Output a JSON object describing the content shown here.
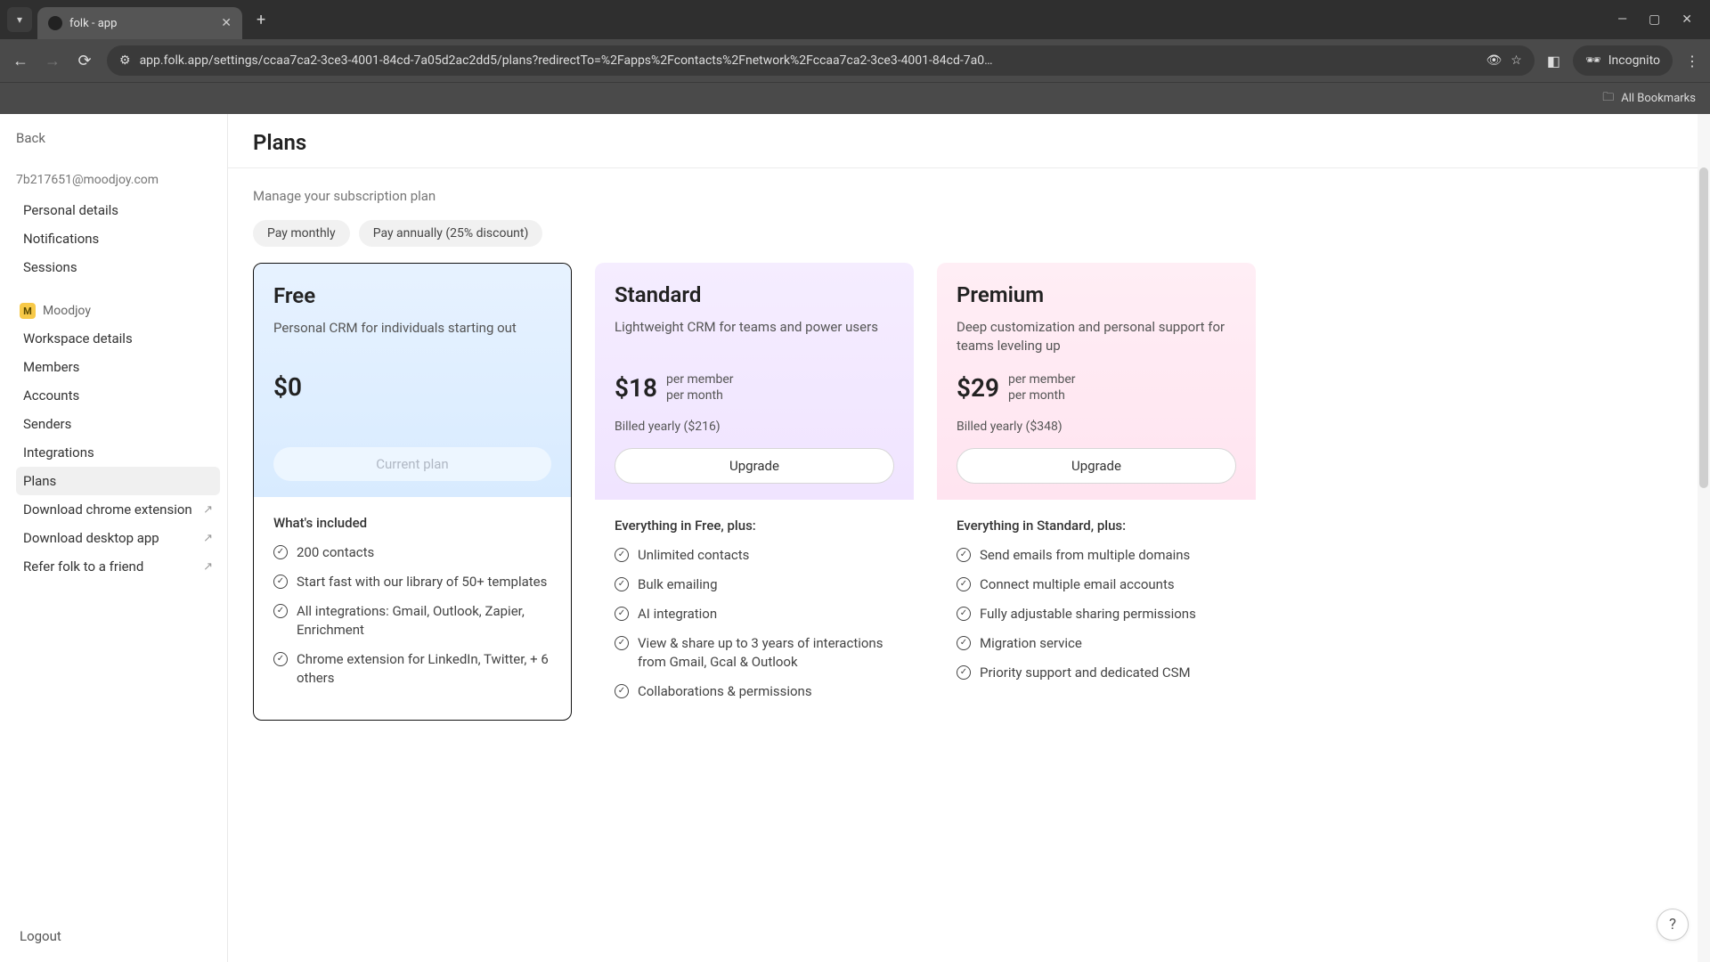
{
  "browser": {
    "tab_title": "folk - app",
    "url": "app.folk.app/settings/ccaa7ca2-3ce3-4001-84cd-7a05d2ac2dd5/plans?redirectTo=%2Fapps%2Fcontacts%2Fnetwork%2Fccaa7ca2-3ce3-4001-84cd-7a0…",
    "incognito": "Incognito",
    "all_bookmarks": "All Bookmarks"
  },
  "sidebar": {
    "back": "Back",
    "email": "7b217651@moodjoy.com",
    "items_account": [
      "Personal details",
      "Notifications",
      "Sessions"
    ],
    "workspace_name": "Moodjoy",
    "workspace_letter": "M",
    "items_workspace": [
      "Workspace details",
      "Members",
      "Accounts",
      "Senders",
      "Integrations",
      "Plans",
      "Download chrome extension",
      "Download desktop app",
      "Refer folk to a friend"
    ],
    "logout": "Logout"
  },
  "page": {
    "title": "Plans",
    "subtitle": "Manage your subscription plan",
    "toggle": {
      "monthly": "Pay monthly",
      "annually": "Pay annually (25% discount)"
    }
  },
  "plans": {
    "free": {
      "name": "Free",
      "desc": "Personal CRM for individuals starting out",
      "price": "$0",
      "button": "Current plan",
      "included_title": "What's included",
      "features": [
        "200 contacts",
        "Start fast with our library of 50+ templates",
        "All integrations: Gmail, Outlook, Zapier, Enrichment",
        "Chrome extension for LinkedIn, Twitter, + 6 others"
      ]
    },
    "standard": {
      "name": "Standard",
      "desc": "Lightweight CRM for teams and power users",
      "price": "$18",
      "unit1": "per member",
      "unit2": "per month",
      "billed": "Billed yearly ($216)",
      "button": "Upgrade",
      "included_title": "Everything in Free, plus:",
      "features": [
        "Unlimited contacts",
        "Bulk emailing",
        "AI integration",
        "View & share up to 3 years of interactions from Gmail, Gcal & Outlook",
        "Collaborations & permissions"
      ]
    },
    "premium": {
      "name": "Premium",
      "desc": "Deep customization and personal support for teams leveling up",
      "price": "$29",
      "unit1": "per member",
      "unit2": "per month",
      "billed": "Billed yearly ($348)",
      "button": "Upgrade",
      "included_title": "Everything in Standard, plus:",
      "features": [
        "Send emails from multiple domains",
        "Connect multiple email accounts",
        "Fully adjustable sharing permissions",
        "Migration service",
        "Priority support and dedicated CSM"
      ]
    }
  },
  "help": "?"
}
